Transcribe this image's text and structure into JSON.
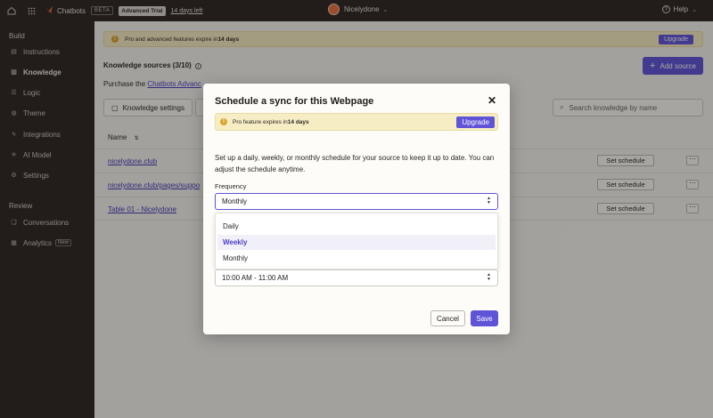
{
  "topbar": {
    "app_name": "Chatbots",
    "beta": "BETA",
    "trial": "Advanced Trial",
    "days_left": "14 days left",
    "user": "Nicelydone",
    "help": "Help"
  },
  "sidebar": {
    "section_build": "Build",
    "section_review": "Review",
    "items": [
      {
        "label": "Instructions"
      },
      {
        "label": "Knowledge"
      },
      {
        "label": "Logic"
      },
      {
        "label": "Theme"
      },
      {
        "label": "Integrations"
      },
      {
        "label": "AI Model"
      },
      {
        "label": "Settings"
      },
      {
        "label": "Conversations"
      },
      {
        "label": "Analytics"
      }
    ],
    "new_badge": "New"
  },
  "main": {
    "banner_prefix": "Pro and advanced features expire in ",
    "banner_bold": "14 days",
    "upgrade": "Upgrade",
    "ks_title": "Knowledge sources (3/10)",
    "add_source": "Add source",
    "purchase_prefix": "Purchase the ",
    "purchase_link": "Chatbots Advanc",
    "knowledge_settings": "Knowledge settings",
    "search_placeholder": "Search knowledge by name",
    "col_name": "Name",
    "rows": [
      {
        "name": "nicelydone.club",
        "action": "Set schedule"
      },
      {
        "name": "nicelydone.club/pages/suppo",
        "action": "Set schedule"
      },
      {
        "name": "Table 01 - Nicelydone",
        "action": "Set schedule"
      }
    ]
  },
  "modal": {
    "title": "Schedule a sync for this Webpage",
    "close": "✕",
    "banner_prefix": "Pro feature expires in ",
    "banner_bold": "14 days",
    "upgrade": "Upgrade",
    "description": "Set up a daily, weekly, or monthly schedule for your source to keep it up to date. You can adjust the schedule anytime.",
    "frequency_label": "Frequency",
    "frequency_value": "Monthly",
    "options": [
      "Daily",
      "Weekly",
      "Monthly"
    ],
    "time_value": "10:00 AM - 11:00 AM",
    "cancel": "Cancel",
    "save": "Save"
  },
  "colors": {
    "accent": "#5f53d8",
    "sidebar_bg": "#2c2623",
    "warning_bg": "#f7edc4"
  }
}
